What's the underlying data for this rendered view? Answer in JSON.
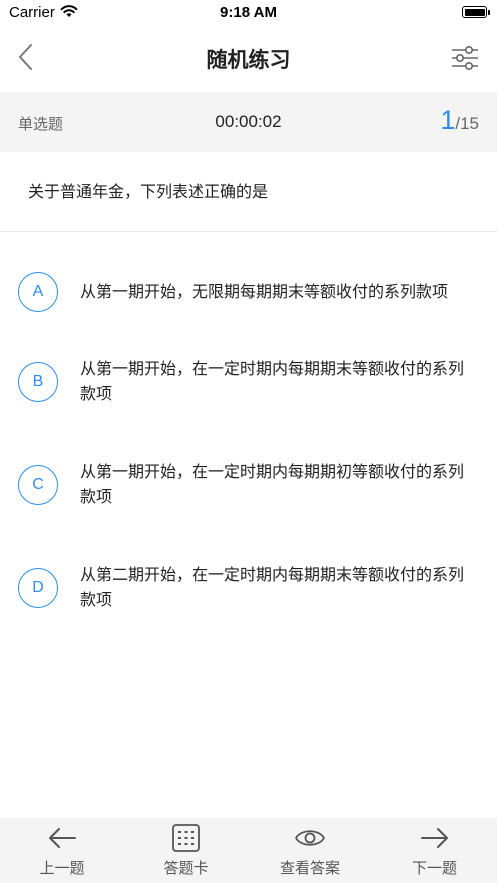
{
  "status_bar": {
    "carrier": "Carrier",
    "time": "9:18 AM"
  },
  "nav": {
    "title": "随机练习"
  },
  "info": {
    "question_type": "单选题",
    "timer": "00:00:02",
    "current": "1",
    "total": "/15"
  },
  "question": {
    "text": "关于普通年金，下列表述正确的是"
  },
  "options": [
    {
      "letter": "A",
      "text": "从第一期开始，无限期每期期末等额收付的系列款项"
    },
    {
      "letter": "B",
      "text": "从第一期开始，在一定时期内每期期末等额收付的系列款项"
    },
    {
      "letter": "C",
      "text": "从第一期开始，在一定时期内每期期初等额收付的系列款项"
    },
    {
      "letter": "D",
      "text": "从第二期开始，在一定时期内每期期末等额收付的系列款项"
    }
  ],
  "bottom_tabs": {
    "prev": "上一题",
    "card": "答题卡",
    "answer": "查看答案",
    "next": "下一题"
  },
  "colors": {
    "accent": "#2d8cf0",
    "bar_bg": "#f4f4f4"
  }
}
